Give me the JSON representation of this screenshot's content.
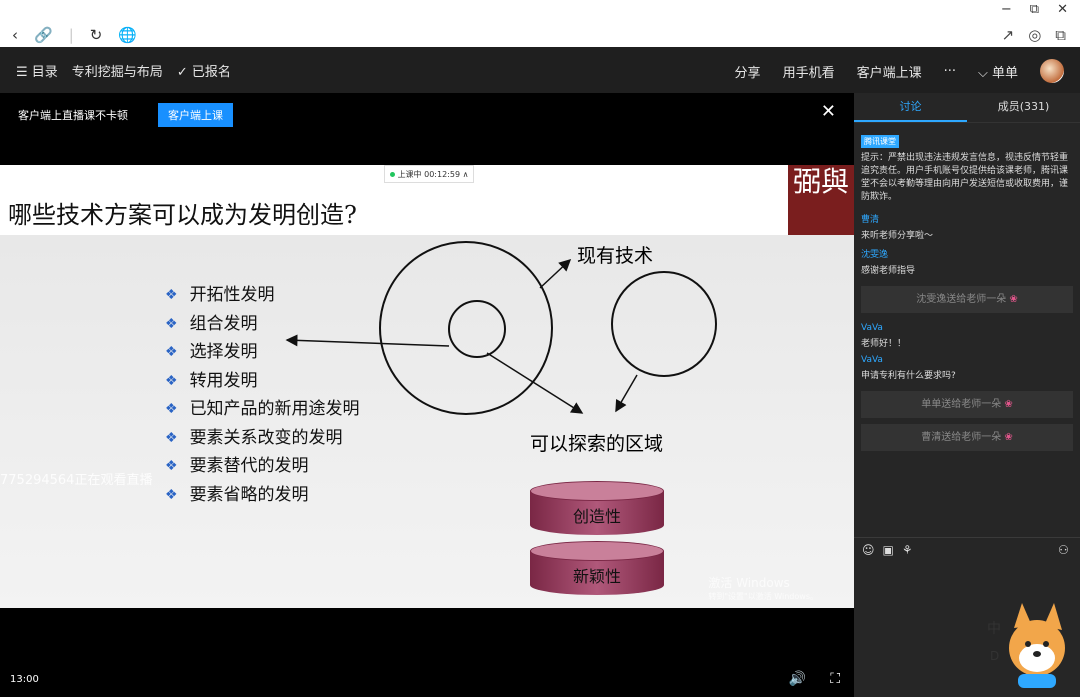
{
  "window": {
    "nav": [
      "‹",
      "🔗",
      "|",
      "↻",
      "🌐"
    ],
    "controls": [
      "−",
      "⧉",
      "✕"
    ],
    "right_icons": [
      "↗",
      "◎",
      "⧉"
    ]
  },
  "topbar": {
    "menu": "☰ 目录",
    "course": "专利挖掘与布局",
    "enrolled": "✓ 已报名",
    "share": "分享",
    "mobile": "用手机看",
    "client": "客户端上课",
    "more": "···",
    "user": "⌵ 单单"
  },
  "banner": {
    "text": "客户端上直播课不卡顿",
    "button": "客户端上课"
  },
  "live": {
    "status": "上课中 00:12:59 ∧"
  },
  "slide": {
    "title": "哪些技术方案可以成为发明创造?",
    "logo": "弼與",
    "bullets": [
      "开拓性发明",
      "组合发明",
      "选择发明",
      "转用发明",
      "已知产品的新用途发明",
      "要素关系改变的发明",
      "要素替代的发明",
      "要素省略的发明"
    ],
    "overlay": "775294564正在观看直播",
    "tech_label": "现有技术",
    "area_label": "可以探索的区域",
    "cyl_top": "创造性",
    "cyl_bottom": "新颖性",
    "win_activate": "激活 Windows",
    "win_activate_sub": "转到\"设置\"以激活 Windows。"
  },
  "player": {
    "time": "13:00"
  },
  "sidebar": {
    "tabs": [
      "讨论",
      "成员(331)"
    ],
    "system_badge": "腾讯课堂",
    "system_text": "提示：严禁出现违法违规发言信息，视违反情节轻重追究责任。用户手机账号仅提供给该课老师，腾讯课堂不会以考勤等理由向用户发送短信或收取费用，谨防欺诈。",
    "messages": [
      {
        "user": "曹清",
        "text": "来听老师分享啦～"
      },
      {
        "user": "沈雯逸",
        "text": "感谢老师指导"
      }
    ],
    "gift1": "沈雯逸送给老师一朵",
    "messages2": [
      {
        "user": "VaVa",
        "text": "老师好！！"
      },
      {
        "user": "VaVa",
        "text": "申请专利有什么要求吗?"
      }
    ],
    "gift2": "单单送给老师一朵",
    "gift3": "曹清送给老师一朵",
    "corgi_text": "中"
  }
}
